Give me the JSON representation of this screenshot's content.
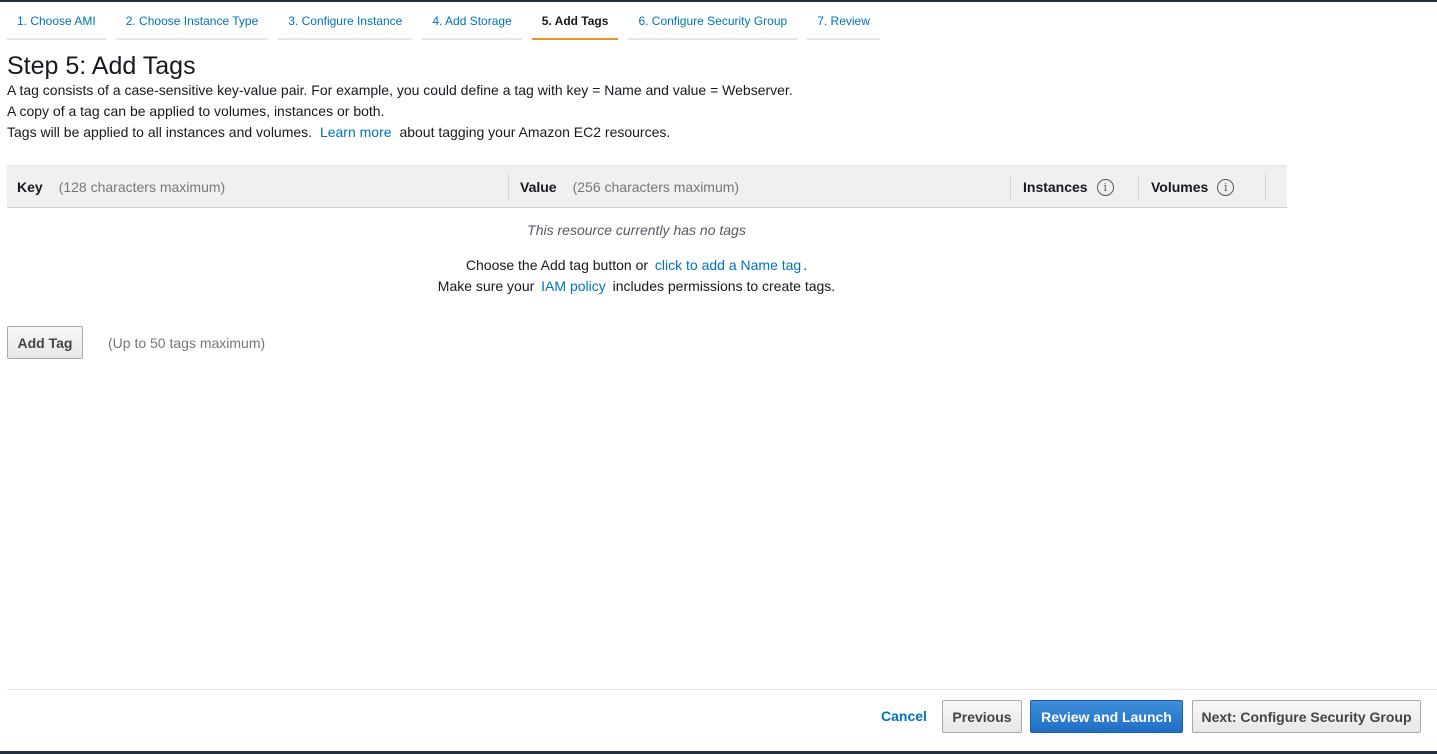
{
  "wizard": {
    "tabs": [
      {
        "label": "1. Choose AMI"
      },
      {
        "label": "2. Choose Instance Type"
      },
      {
        "label": "3. Configure Instance"
      },
      {
        "label": "4. Add Storage"
      },
      {
        "label": "5. Add Tags"
      },
      {
        "label": "6. Configure Security Group"
      },
      {
        "label": "7. Review"
      }
    ],
    "active_index": 4
  },
  "main": {
    "title": "Step 5: Add Tags",
    "description": {
      "line1": "A tag consists of a case-sensitive key-value pair. For example, you could define a tag with key = Name and value = Webserver.",
      "line2": "A copy of a tag can be applied to volumes, instances or both.",
      "line3_prefix": "Tags will be applied to all instances and volumes.",
      "line3_link": "Learn more",
      "line3_suffix": "about tagging your Amazon EC2 resources."
    }
  },
  "table": {
    "columns": {
      "key_label": "Key",
      "key_hint": "(128 characters maximum)",
      "value_label": "Value",
      "value_hint": "(256 characters maximum)",
      "instances_label": "Instances",
      "volumes_label": "Volumes"
    },
    "info_icon": "i",
    "empty_message": "This resource currently has no tags",
    "hint1_prefix": "Choose the Add tag button or",
    "hint1_link": "click to add a Name tag",
    "hint1_suffix": ".",
    "hint2_prefix": "Make sure your",
    "hint2_link": "IAM policy",
    "hint2_suffix": "includes permissions to create tags."
  },
  "actions": {
    "add_tag_label": "Add Tag",
    "add_tag_hint": "(Up to 50 tags maximum)"
  },
  "footer": {
    "cancel_label": "Cancel",
    "previous_label": "Previous",
    "review_launch_label": "Review and Launch",
    "next_label": "Next: Configure Security Group"
  },
  "colors": {
    "link": "#0073bb",
    "primary_button": "#2a7dd6",
    "active_tab_underline": "#ec912d"
  }
}
